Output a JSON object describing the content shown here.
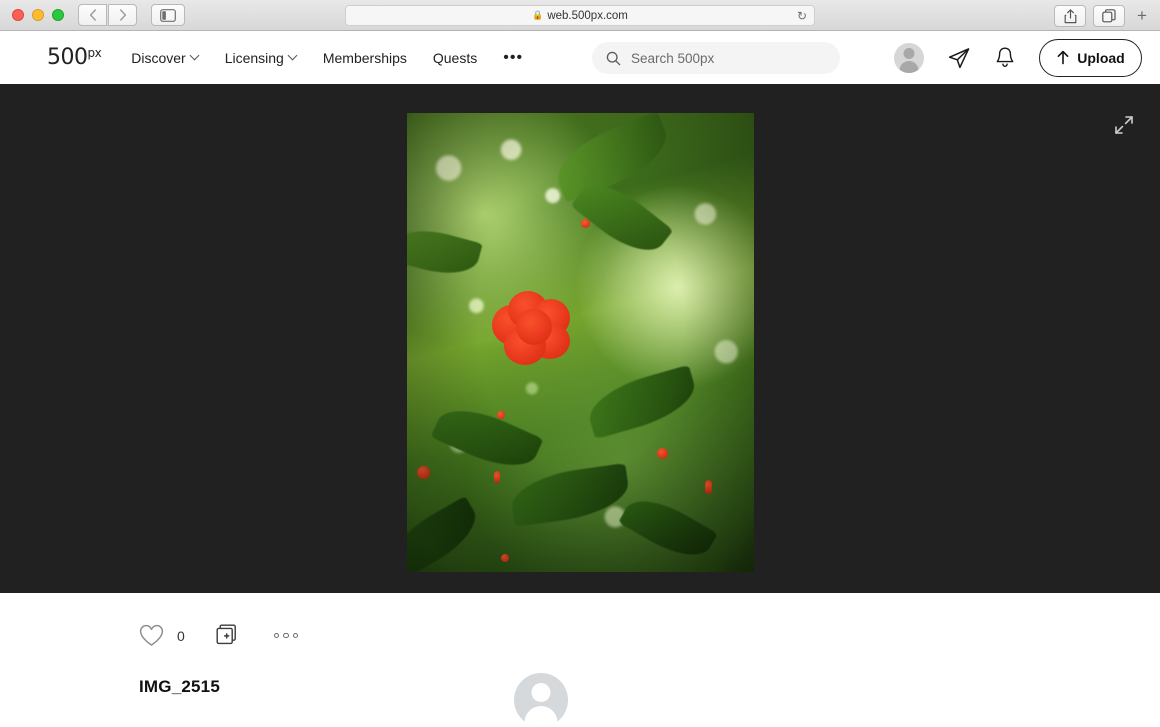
{
  "browser": {
    "url": "web.500px.com",
    "lock_icon": "lock-icon",
    "reload_icon": "reload-icon",
    "back_icon": "chevron-left-icon",
    "forward_icon": "chevron-right-icon",
    "sidebar_icon": "sidebar-toggle-icon",
    "share_icon": "share-icon",
    "tabs_icon": "show-tabs-icon",
    "new_tab_icon": "plus-icon",
    "traffic_lights": [
      "close",
      "minimize",
      "maximize"
    ]
  },
  "site_nav": {
    "logo": "500",
    "logo_sup": "px",
    "links": [
      {
        "label": "Discover",
        "has_caret": true
      },
      {
        "label": "Licensing",
        "has_caret": true
      },
      {
        "label": "Memberships",
        "has_caret": false
      },
      {
        "label": "Quests",
        "has_caret": false
      }
    ],
    "more_label": "•••",
    "search": {
      "placeholder": "Search 500px",
      "value": "",
      "icon": "search-icon"
    },
    "avatar_icon": "user-avatar-icon",
    "messages_icon": "paper-plane-icon",
    "notifications_icon": "bell-icon",
    "upload": {
      "label": "Upload",
      "icon": "arrow-up-icon"
    }
  },
  "photo_stage": {
    "background_color": "#212121",
    "expand_icon": "expand-arrows-icon",
    "photo_alt": "Red flower blossom on a green leafy tree branch"
  },
  "details": {
    "like": {
      "icon": "heart-icon",
      "count": "0"
    },
    "add_to_gallery_icon": "add-to-gallery-icon",
    "more_icon": "more-options-icon",
    "title": "IMG_2515",
    "author_avatar_icon": "author-avatar-icon"
  },
  "colors": {
    "stage_background": "#212121",
    "page_background": "#ffffff",
    "text_primary": "#111111",
    "accent_flower": "#e8381c",
    "chrome_background": "#e0e0e0"
  }
}
